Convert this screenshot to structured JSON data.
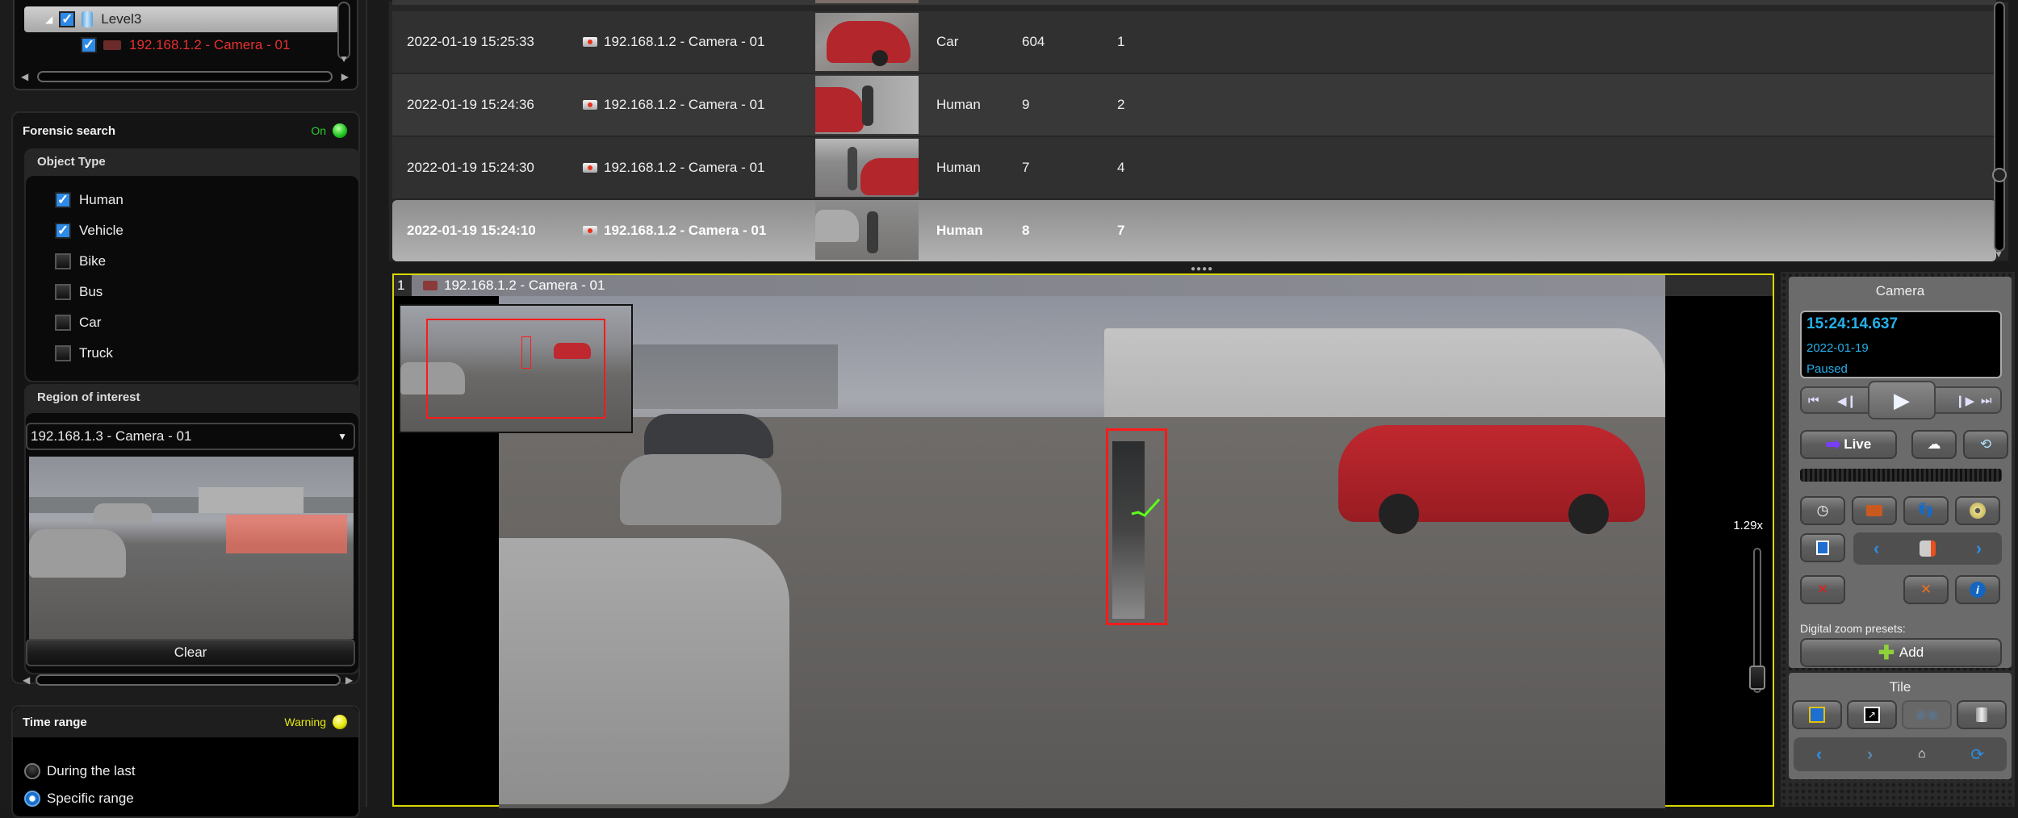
{
  "tree": {
    "level_label": "Level3",
    "camera_label": "192.168.1.2 - Camera - 01",
    "camera_color": "#e83030"
  },
  "forensic": {
    "title": "Forensic search",
    "status": "On",
    "status_color": "#2ecc2e"
  },
  "object_type": {
    "title": "Object Type",
    "items": [
      {
        "label": "Human",
        "checked": true
      },
      {
        "label": "Vehicle",
        "checked": true
      },
      {
        "label": "Bike",
        "checked": false
      },
      {
        "label": "Bus",
        "checked": false
      },
      {
        "label": "Car",
        "checked": false
      },
      {
        "label": "Truck",
        "checked": false
      }
    ]
  },
  "roi": {
    "title": "Region of interest",
    "camera_select": "192.168.1.3 - Camera - 01",
    "clear_label": "Clear"
  },
  "time_range": {
    "title": "Time range",
    "status": "Warning",
    "status_color": "#e6e60d",
    "options": [
      {
        "label": "During the last",
        "selected": false
      },
      {
        "label": "Specific range",
        "selected": true
      }
    ]
  },
  "results": {
    "rows": [
      {
        "time": "2022-01-19 15:25:33",
        "camera": "192.168.1.2 - Camera - 01",
        "type": "Car",
        "size": "604",
        "score": "1"
      },
      {
        "time": "2022-01-19 15:24:36",
        "camera": "192.168.1.2 - Camera - 01",
        "type": "Human",
        "size": "9",
        "score": "2"
      },
      {
        "time": "2022-01-19 15:24:30",
        "camera": "192.168.1.2 - Camera - 01",
        "type": "Human",
        "size": "7",
        "score": "4"
      },
      {
        "time": "2022-01-19 15:24:10",
        "camera": "192.168.1.2 - Camera - 01",
        "type": "Human",
        "size": "8",
        "score": "7",
        "selected": true
      }
    ]
  },
  "tile": {
    "number": "1",
    "camera": "192.168.1.2 - Camera - 01",
    "zoom_level": "1.29x",
    "highlight_color": "#d8d800"
  },
  "camera_panel": {
    "title": "Camera",
    "time": "15:24:14.637",
    "date": "2022-01-19",
    "state": "Paused",
    "live_label": "Live",
    "digital_zoom_label": "Digital zoom presets:",
    "add_label": "Add"
  },
  "tile_panel": {
    "title": "Tile"
  }
}
